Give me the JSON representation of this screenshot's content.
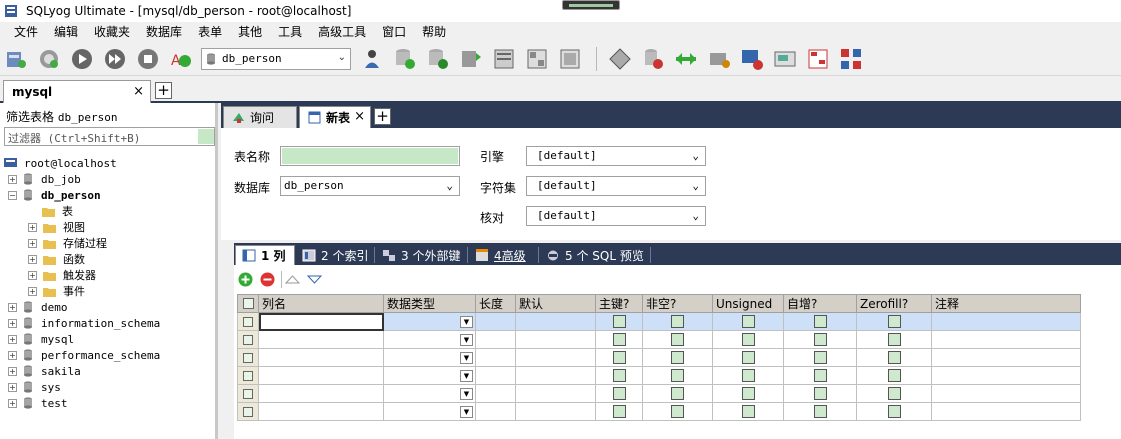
{
  "window": {
    "title": "SQLyog Ultimate - [mysql/db_person - root@localhost]"
  },
  "menu": [
    "文件",
    "编辑",
    "收藏夹",
    "数据库",
    "表单",
    "其他",
    "工具",
    "高级工具",
    "窗口",
    "帮助"
  ],
  "toolbar": {
    "database_select": "db_person"
  },
  "connection_tab": {
    "label": "mysql",
    "close": "×",
    "add": "+"
  },
  "left_panel": {
    "filter_label": "筛选表格",
    "filter_db": "db_person",
    "filter_placeholder": "过滤器 (Ctrl+Shift+B)",
    "root": "root@localhost",
    "databases": [
      {
        "name": "db_job",
        "expanded": false
      },
      {
        "name": "db_person",
        "expanded": true
      },
      {
        "name": "demo",
        "expanded": false
      },
      {
        "name": "information_schema",
        "expanded": false
      },
      {
        "name": "mysql",
        "expanded": false
      },
      {
        "name": "performance_schema",
        "expanded": false
      },
      {
        "name": "sakila",
        "expanded": false
      },
      {
        "name": "sys",
        "expanded": false
      },
      {
        "name": "test",
        "expanded": false
      }
    ],
    "db_children": [
      "表",
      "视图",
      "存储过程",
      "函数",
      "触发器",
      "事件"
    ]
  },
  "query_tabs": {
    "query": "询问",
    "new_table": "新表",
    "close": "×",
    "add": "+"
  },
  "form": {
    "table_name_label": "表名称",
    "table_name_value": "",
    "database_label": "数据库",
    "database_value": "db_person",
    "engine_label": "引擎",
    "engine_value": "[default]",
    "charset_label": "字符集",
    "charset_value": "[default]",
    "collation_label": "核对",
    "collation_value": "[default]"
  },
  "sub_tabs": [
    "1 列",
    "2 个索引",
    "3 个外部键",
    "4高级",
    "5 个 SQL 预览"
  ],
  "columns_grid": {
    "headers": [
      "列名",
      "数据类型",
      "长度",
      "默认",
      "主键?",
      "非空?",
      "Unsigned",
      "自增?",
      "Zerofill?",
      "注释"
    ],
    "row_count": 6
  }
}
